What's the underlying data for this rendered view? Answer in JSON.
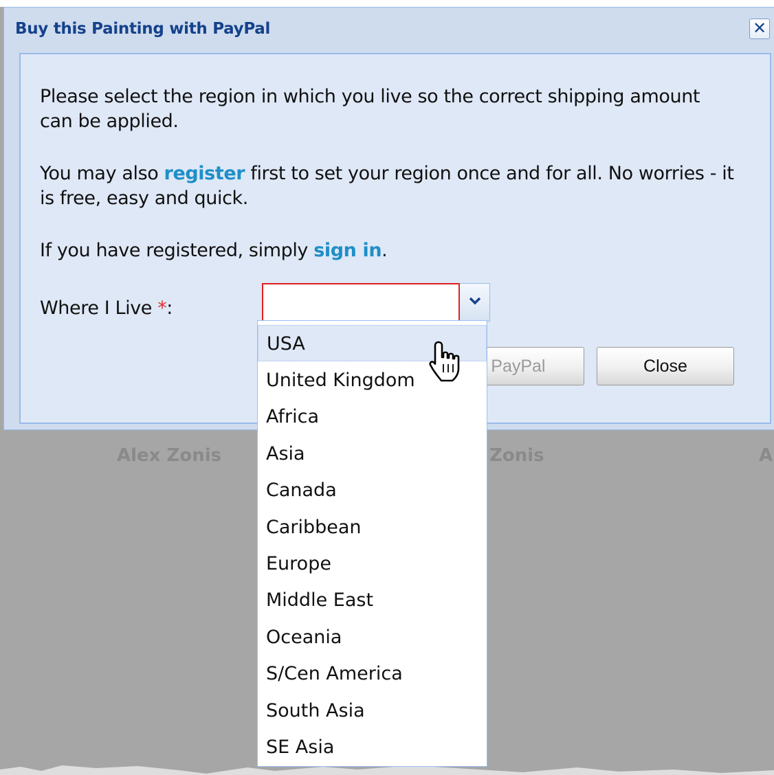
{
  "dialog": {
    "title": "Buy this Painting with PayPal",
    "close_icon_glyph": "✕",
    "paragraph1": "Please select the region in which you live so the correct shipping amount can be applied.",
    "paragraph2": {
      "before": "You may also ",
      "link": "register",
      "after": " first to set your region once and for all. No worries - it is free, easy and quick."
    },
    "paragraph3": {
      "before": "If you have registered, simply ",
      "link": "sign in",
      "after": "."
    },
    "field": {
      "label": "Where I Live ",
      "required_marker": "*",
      "label_suffix": ":",
      "value": ""
    },
    "buttons": {
      "paypal": "to PayPal",
      "close": "Close"
    }
  },
  "dropdown": {
    "options": [
      "USA",
      "United Kingdom",
      "Africa",
      "Asia",
      "Canada",
      "Caribbean",
      "Europe",
      "Middle East",
      "Oceania",
      "S/Cen America",
      "South Asia",
      "SE Asia"
    ],
    "highlighted": "USA"
  },
  "background": {
    "names": [
      "Alex Zonis",
      "Zonis",
      "A"
    ]
  },
  "colors": {
    "title": "#15428b",
    "link": "#1e8fc8",
    "required": "#e03030",
    "invalid_border": "#e02020",
    "overlay": "#a6a6a6"
  },
  "icons": {
    "trigger": "chevron-down-icon",
    "cursor": "hand-pointer-icon"
  }
}
